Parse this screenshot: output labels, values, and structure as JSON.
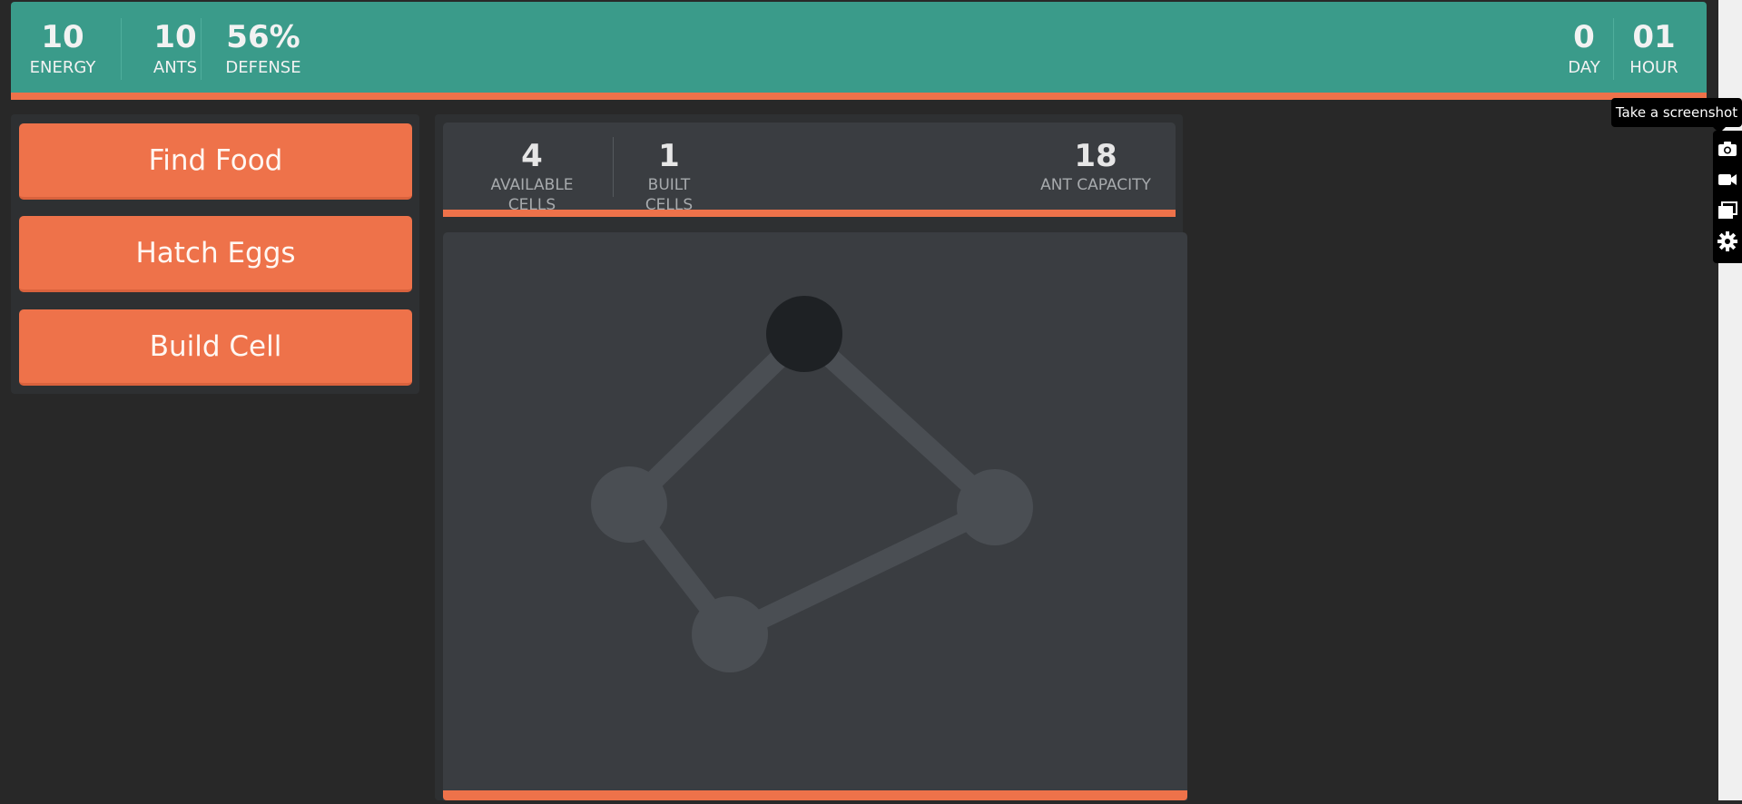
{
  "header": {
    "stats_left": [
      {
        "value": "10",
        "label": "ENERGY"
      },
      {
        "value": "10",
        "label": "ANTS"
      },
      {
        "value": "56%",
        "label": "DEFENSE"
      }
    ],
    "stats_right": [
      {
        "value": "0",
        "label": "DAY"
      },
      {
        "value": "01",
        "label": "HOUR"
      }
    ]
  },
  "actions": [
    {
      "label": "Find Food"
    },
    {
      "label": "Hatch Eggs"
    },
    {
      "label": "Build Cell"
    }
  ],
  "colony": {
    "stats": [
      {
        "value": "4",
        "label": "AVAILABLE CELLS"
      },
      {
        "value": "1",
        "label": "BUILT CELLS"
      },
      {
        "value": "18",
        "label": "ANT CAPACITY"
      }
    ]
  },
  "tools": {
    "tooltip": "Take a screenshot",
    "items": [
      "camera-icon",
      "video-icon",
      "window-icon",
      "gear-icon"
    ]
  },
  "colors": {
    "header": "#3a9b8a",
    "accent": "#ee724a",
    "background": "#282828",
    "panel": "#3a3d41",
    "node": "#4a4e53",
    "built_node": "#1e2124"
  }
}
